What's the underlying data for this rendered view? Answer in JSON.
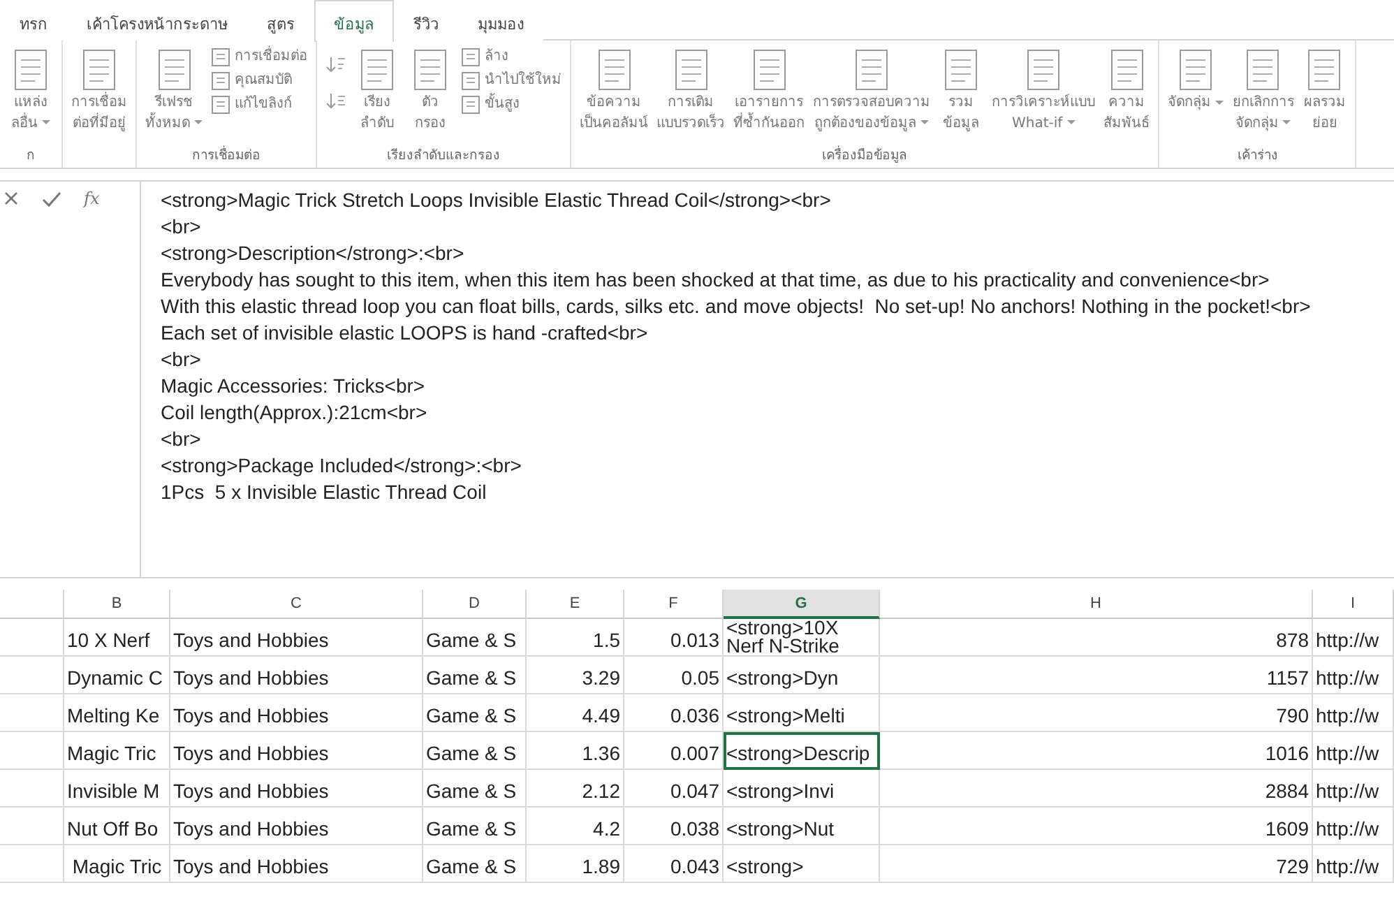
{
  "tabs": [
    {
      "label": "ทรก",
      "selected": false
    },
    {
      "label": "เค้าโครงหน้ากระดาษ",
      "selected": false
    },
    {
      "label": "สูตร",
      "selected": false
    },
    {
      "label": "ข้อมูล",
      "selected": true
    },
    {
      "label": "รีวิว",
      "selected": false
    },
    {
      "label": "มุมมอง",
      "selected": false
    }
  ],
  "ribbon_groups": [
    {
      "label": "ก",
      "items": [
        {
          "kind": "large",
          "lines": [
            "แหล่ง",
            "ลอื่น"
          ],
          "dropdown": true
        }
      ]
    },
    {
      "items": [
        {
          "kind": "large",
          "lines": [
            "การเชื่อม",
            "ต่อที่มีอยู่"
          ],
          "dropdown": false
        }
      ]
    },
    {
      "label": "การเชื่อมต่อ",
      "items": [
        {
          "kind": "large",
          "lines": [
            "รีเฟรช",
            "ทั้งหมด"
          ],
          "dropdown": true
        },
        {
          "kind": "stack",
          "entries": [
            "การเชื่อมต่อ",
            "คุณสมบัติ",
            "แก้ไขลิงก์"
          ]
        }
      ]
    },
    {
      "label": "เรียงลำดับและกรอง",
      "items": [
        {
          "kind": "sortpair"
        },
        {
          "kind": "large",
          "lines": [
            "เรียง",
            "ลำดับ"
          ],
          "dropdown": false
        },
        {
          "kind": "large",
          "lines": [
            "ตัว",
            "กรอง"
          ],
          "dropdown": false
        },
        {
          "kind": "stack",
          "entries": [
            "ล้าง",
            "นำไปใช้ใหม่",
            "ขั้นสูง"
          ]
        }
      ]
    },
    {
      "label": "เครื่องมือข้อมูล",
      "items": [
        {
          "kind": "large",
          "lines": [
            "ข้อความ",
            "เป็นคอลัมน์"
          ],
          "dropdown": false
        },
        {
          "kind": "large",
          "lines": [
            "การเติม",
            "แบบรวดเร็ว"
          ],
          "dropdown": false
        },
        {
          "kind": "large",
          "lines": [
            "เอารายการ",
            "ที่ซ้ำกันออก"
          ],
          "dropdown": false
        },
        {
          "kind": "large",
          "lines": [
            "การตรวจสอบความ",
            "ถูกต้องของข้อมูล"
          ],
          "dropdown": true
        },
        {
          "kind": "large",
          "lines": [
            "รวม",
            "ข้อมูล"
          ],
          "dropdown": false
        },
        {
          "kind": "large",
          "lines": [
            "การวิเคราะห์แบบ",
            "What-if"
          ],
          "dropdown": true
        },
        {
          "kind": "large",
          "lines": [
            "ความ",
            "สัมพันธ์"
          ],
          "dropdown": false
        }
      ]
    },
    {
      "label": "เค้าร่าง",
      "items": [
        {
          "kind": "large",
          "lines": [
            "จัดกลุ่ม"
          ],
          "dropdown": true
        },
        {
          "kind": "large",
          "lines": [
            "ยกเลิกการ",
            "จัดกลุ่ม"
          ],
          "dropdown": true
        },
        {
          "kind": "large",
          "lines": [
            "ผลรวม",
            "ย่อย"
          ],
          "dropdown": false
        }
      ]
    }
  ],
  "formula_bar": {
    "function_label": "fx",
    "lines": [
      "<strong>Magic Trick Stretch Loops Invisible Elastic Thread Coil</strong><br>",
      "<br>",
      "<strong>Description</strong>:<br>",
      "Everybody has sought to this item, when this item has been shocked at that time, as due to his practicality and convenience<br>",
      "With this elastic thread loop you can float bills, cards, silks etc. and move objects!  No set-up! No anchors! Nothing in the pocket!<br>",
      "Each set of invisible elastic LOOPS is hand -crafted<br>",
      "<br>",
      "Magic Accessories: Tricks<br>",
      "Coil length(Approx.):21cm<br>",
      "<br>",
      "<strong>Package Included</strong>:<br>",
      "1Pcs  5 x Invisible Elastic Thread Coil"
    ]
  },
  "table": {
    "columns": [
      {
        "label": "B",
        "selected": false
      },
      {
        "label": "C",
        "selected": false
      },
      {
        "label": "D",
        "selected": false
      },
      {
        "label": "E",
        "selected": false
      },
      {
        "label": "F",
        "selected": false
      },
      {
        "label": "G",
        "selected": true
      },
      {
        "label": "H",
        "selected": false
      },
      {
        "label": "I",
        "selected": false
      }
    ],
    "rows": [
      {
        "cells": [
          "10 X Nerf",
          "Toys and Hobbies",
          "Game & S",
          "1.5",
          "0.013",
          "<strong>10X\nNerf N-Strike",
          "878",
          "http://w"
        ],
        "selected": false
      },
      {
        "cells": [
          "Dynamic C",
          "Toys and Hobbies",
          "Game & S",
          "3.29",
          "0.05",
          "<strong>Dyn",
          "1157",
          "http://w"
        ],
        "selected": false
      },
      {
        "cells": [
          "Melting Ke",
          "Toys and Hobbies",
          "Game & S",
          "4.49",
          "0.036",
          "<strong>Melti",
          "790",
          "http://w"
        ],
        "selected": false
      },
      {
        "cells": [
          "Magic Tric",
          "Toys and Hobbies",
          "Game & S",
          "1.36",
          "0.007",
          "<strong>Descrip",
          "1016",
          "http://w"
        ],
        "selected": true
      },
      {
        "cells": [
          "Invisible M",
          "Toys and Hobbies",
          "Game & S",
          "2.12",
          "0.047",
          "<strong>Invi",
          "2884",
          "http://w"
        ],
        "selected": false
      },
      {
        "cells": [
          "Nut Off Bo",
          "Toys and Hobbies",
          "Game & S",
          "4.2",
          "0.038",
          "<strong>Nut",
          "1609",
          "http://w"
        ],
        "selected": false
      },
      {
        "cells": [
          " Magic Tric",
          "Toys and Hobbies",
          "Game & S",
          "1.89",
          "0.043",
          "<strong>",
          "729",
          "http://w"
        ],
        "selected": false
      }
    ]
  }
}
